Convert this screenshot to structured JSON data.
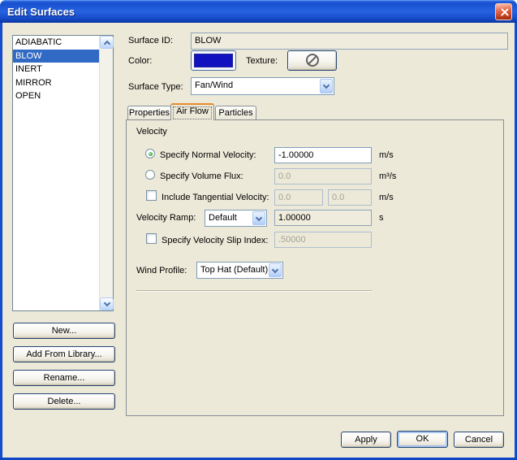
{
  "window": {
    "title": "Edit Surfaces"
  },
  "colors": {
    "dialog_bg": "#ECE9D8",
    "titlebar_blue": "#2563DF",
    "selection_blue": "#316AC5",
    "swatch_navy": "#1111C0",
    "tab_accent_orange": "#E68B2C",
    "frame_blue": "#0E45C4"
  },
  "icons": {
    "close": "x-cross",
    "texture_none": "slashed-circle",
    "combo_arrow": "chevron-down",
    "scroll_up": "chevron-up",
    "scroll_down": "chevron-down"
  },
  "surface_list": {
    "items": [
      "ADIABATIC",
      "BLOW",
      "INERT",
      "MIRROR",
      "OPEN"
    ],
    "selected": "BLOW"
  },
  "list_actions": [
    "New...",
    "Add From Library...",
    "Rename...",
    "Delete..."
  ],
  "header": {
    "surface_id": {
      "label": "Surface ID:",
      "value": "BLOW"
    },
    "color": {
      "label": "Color:"
    },
    "texture": {
      "label": "Texture:"
    },
    "surface_type": {
      "label": "Surface Type:",
      "value": "Fan/Wind"
    }
  },
  "tabs": [
    {
      "label": "Properties"
    },
    {
      "label": "Air Flow"
    },
    {
      "label": "Particles"
    }
  ],
  "active_tab": "Air Flow",
  "air_flow": {
    "section_title": "Velocity",
    "normal_velocity": {
      "label": "Specify Normal Velocity:",
      "value": "-1.00000",
      "unit": "m/s",
      "selected": true
    },
    "volume_flux": {
      "label": "Specify Volume Flux:",
      "value": "0.0",
      "unit": "m³/s",
      "selected": false
    },
    "tangential_velocity": {
      "label": "Include Tangential Velocity:",
      "value_1": "0.0",
      "value_2": "0.0",
      "unit": "m/s",
      "checked": false
    },
    "velocity_ramp": {
      "label": "Velocity Ramp:",
      "selected_option": "Default",
      "value": "1.00000",
      "unit": "s"
    },
    "slip_index": {
      "label": "Specify Velocity Slip Index:",
      "value": ".50000",
      "checked": false
    },
    "wind_profile": {
      "label": "Wind Profile:",
      "selected_option": "Top Hat (Default)"
    }
  },
  "footer": {
    "apply": "Apply",
    "ok": "OK",
    "cancel": "Cancel"
  }
}
